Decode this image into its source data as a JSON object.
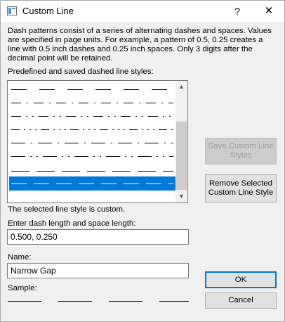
{
  "window": {
    "title": "Custom Line",
    "help_label": "?",
    "close_label": "✕"
  },
  "description": "Dash patterns consist of a series of alternating dashes and spaces.  Values are specified in page units.  For example, a pattern of 0.5, 0.25 creates a line with 0.5 inch dashes and 0.25 inch spaces. Only 3 digits after the decimal point will be retained.",
  "styles_list": {
    "label": "Predefined and saved dashed line styles:",
    "items": [
      {
        "pattern": "long-dash"
      },
      {
        "pattern": "dash-dot"
      },
      {
        "pattern": "dash-dot-dot"
      },
      {
        "pattern": "dash-dot-dot-dot"
      },
      {
        "pattern": "long-dash-dot"
      },
      {
        "pattern": "long-dash-dot-dot"
      },
      {
        "pattern": "long-long-dash"
      },
      {
        "pattern": "narrow-gap",
        "selected": true
      }
    ]
  },
  "status_text": "The selected line style is custom.",
  "dash_input": {
    "label": "Enter dash length and space length:",
    "value": "0.500, 0.250"
  },
  "name_input": {
    "label": "Name:",
    "value": "Narrow Gap"
  },
  "sample_label": "Sample:",
  "buttons": {
    "save": "Save Custom Line Styles",
    "remove": "Remove Selected Custom Line Style",
    "ok": "OK",
    "cancel": "Cancel"
  },
  "colors": {
    "selection": "#0078d7",
    "default_button_border": "#0078d7"
  }
}
